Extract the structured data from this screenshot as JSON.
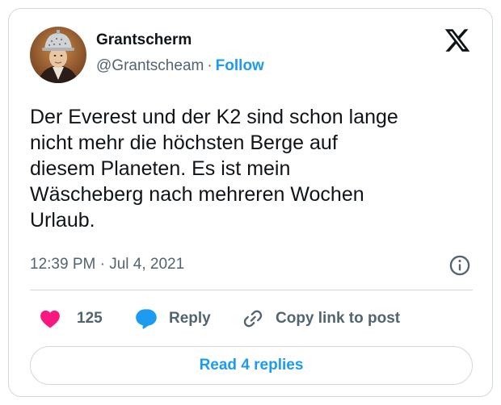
{
  "author": {
    "display_name": "Grantscherm",
    "handle": "@Grantscheam",
    "separator": "·",
    "follow_label": "Follow"
  },
  "tweet": {
    "text": "Der Everest und der K2 sind schon lange\nnicht mehr die höchsten Berge auf\ndiesem Planeten. Es ist mein\nWäscheberg nach mehreren Wochen\nUrlaub.",
    "timestamp": "12:39 PM · Jul 4, 2021"
  },
  "actions": {
    "like_count": "125",
    "reply_label": "Reply",
    "copy_link_label": "Copy link to post"
  },
  "footer": {
    "read_replies_label": "Read 4 replies"
  },
  "icons": {
    "logo": "x-logo-icon",
    "info": "info-icon",
    "like": "heart-icon",
    "reply": "speech-bubble-icon",
    "copy_link": "link-icon"
  },
  "colors": {
    "accent": "#1d9bf0",
    "like": "#f91880",
    "secondary_text": "#536471",
    "border": "#cfd9de"
  }
}
